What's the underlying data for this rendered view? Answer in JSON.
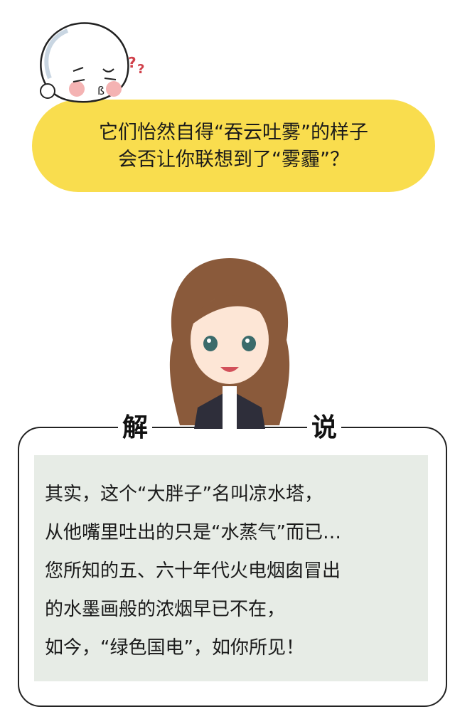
{
  "question": {
    "lines": [
      "它们怡然自得“吞云吐雾”的样子",
      "会否让你联想到了“雾霾”？"
    ]
  },
  "title": {
    "chars": [
      "解",
      "说"
    ]
  },
  "explanation": {
    "lines": [
      "其实，这个“大胖子”名叫凉水塔，",
      "从他嘴里吐出的只是“水蒸气”而已…",
      "您所知的五、六十年代火电烟囱冒出",
      "的水墨画般的浓烟早已不在，",
      "如今，“绿色国电”，如你所见！"
    ]
  },
  "colors": {
    "bubble": "#f9dd4e",
    "panel": "#e7ece6",
    "blush": "#f4b3b3",
    "question_mark": "#d0404a"
  }
}
